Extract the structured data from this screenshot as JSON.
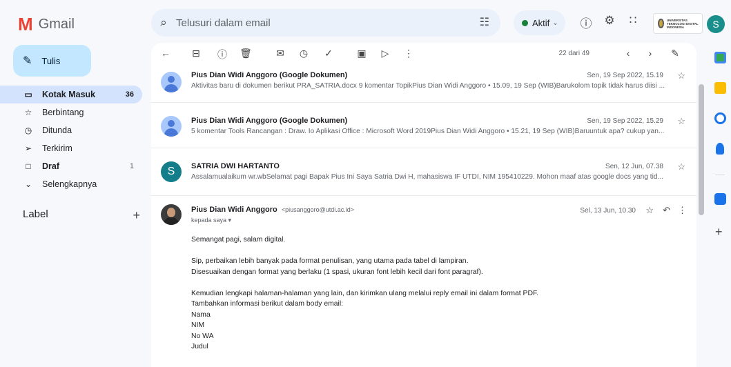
{
  "app": {
    "logo_mark": "M",
    "name": "Gmail"
  },
  "search": {
    "placeholder": "Telusuri dalam email",
    "icon": "search-icon",
    "filter_icon": "tune-icon"
  },
  "status": {
    "label": "Aktif",
    "color": "#188038"
  },
  "header_icons": [
    "help-icon",
    "settings-icon",
    "apps-grid-icon"
  ],
  "org_logo": {
    "text": "UNIVERSITAS TEKNOLOGI DIGITAL INDONESIA"
  },
  "user": {
    "initial": "S",
    "color": "#1a8e8a"
  },
  "compose": {
    "label": "Tulis"
  },
  "nav": [
    {
      "label": "Kotak Masuk",
      "count": "36",
      "icon": "inbox-icon",
      "active": true
    },
    {
      "label": "Berbintang",
      "count": "",
      "icon": "star-icon"
    },
    {
      "label": "Ditunda",
      "count": "",
      "icon": "clock-icon"
    },
    {
      "label": "Terkirim",
      "count": "",
      "icon": "send-icon"
    },
    {
      "label": "Draf",
      "count": "1",
      "icon": "draft-icon"
    },
    {
      "label": "Selengkapnya",
      "count": "",
      "icon": "chevron-down-icon"
    }
  ],
  "labels": {
    "title": "Label"
  },
  "toolbar": {
    "pager": "22 dari 49"
  },
  "messages": [
    {
      "sender": "Pius Dian Widi Anggoro (Google Dokumen)",
      "date": "Sen, 19 Sep 2022, 15.19",
      "snippet": "Aktivitas baru di dokumen berikut PRA_SATRIA.docx 9 komentar TopikPius Dian Widi Anggoro • 15.09, 19 Sep (WIB)Barukolom topik tidak harus diisi ..."
    },
    {
      "sender": "Pius Dian Widi Anggoro (Google Dokumen)",
      "date": "Sen, 19 Sep 2022, 15.29",
      "snippet": "5 komentar Tools Rancangan : Draw. Io Aplikasi Office : Microsoft Word 2019Pius Dian Widi Anggoro • 15.21, 19 Sep (WIB)Baruuntuk apa? cukup yan..."
    },
    {
      "sender": "SATRIA DWI HARTANTO",
      "initial": "S",
      "date": "Sen, 12 Jun, 07.38",
      "snippet": "Assalamualaikum wr.wbSelamat pagi Bapak Pius Ini Saya Satria Dwi H, mahasiswa IF UTDI, NIM 195410229. Mohon maaf atas google docs yang tid..."
    }
  ],
  "open_message": {
    "sender": "Pius Dian Widi Anggoro",
    "address": "<piusanggoro@utdi.ac.id>",
    "to": "kepada saya ▾",
    "date": "Sel, 13 Jun, 10.30",
    "body": {
      "l1": "Semangat pagi, salam digital.",
      "l2": "Sip, perbaikan lebih banyak pada format penulisan, yang utama pada tabel di lampiran.",
      "l3": "Disesuaikan dengan format yang berlaku (1 spasi, ukuran font lebih kecil dari font paragraf).",
      "l4": "Kemudian lengkapi halaman-halaman yang lain, dan kirimkan ulang melalui reply email ini dalam format PDF.",
      "l5": "Tambahkan informasi berikut dalam body email:",
      "l6": "Nama",
      "l7": "NIM",
      "l8": "No WA",
      "l9": "Judul"
    }
  },
  "side_rail": [
    "calendar-icon",
    "keep-icon",
    "tasks-icon",
    "contacts-icon",
    "meet-icon"
  ]
}
